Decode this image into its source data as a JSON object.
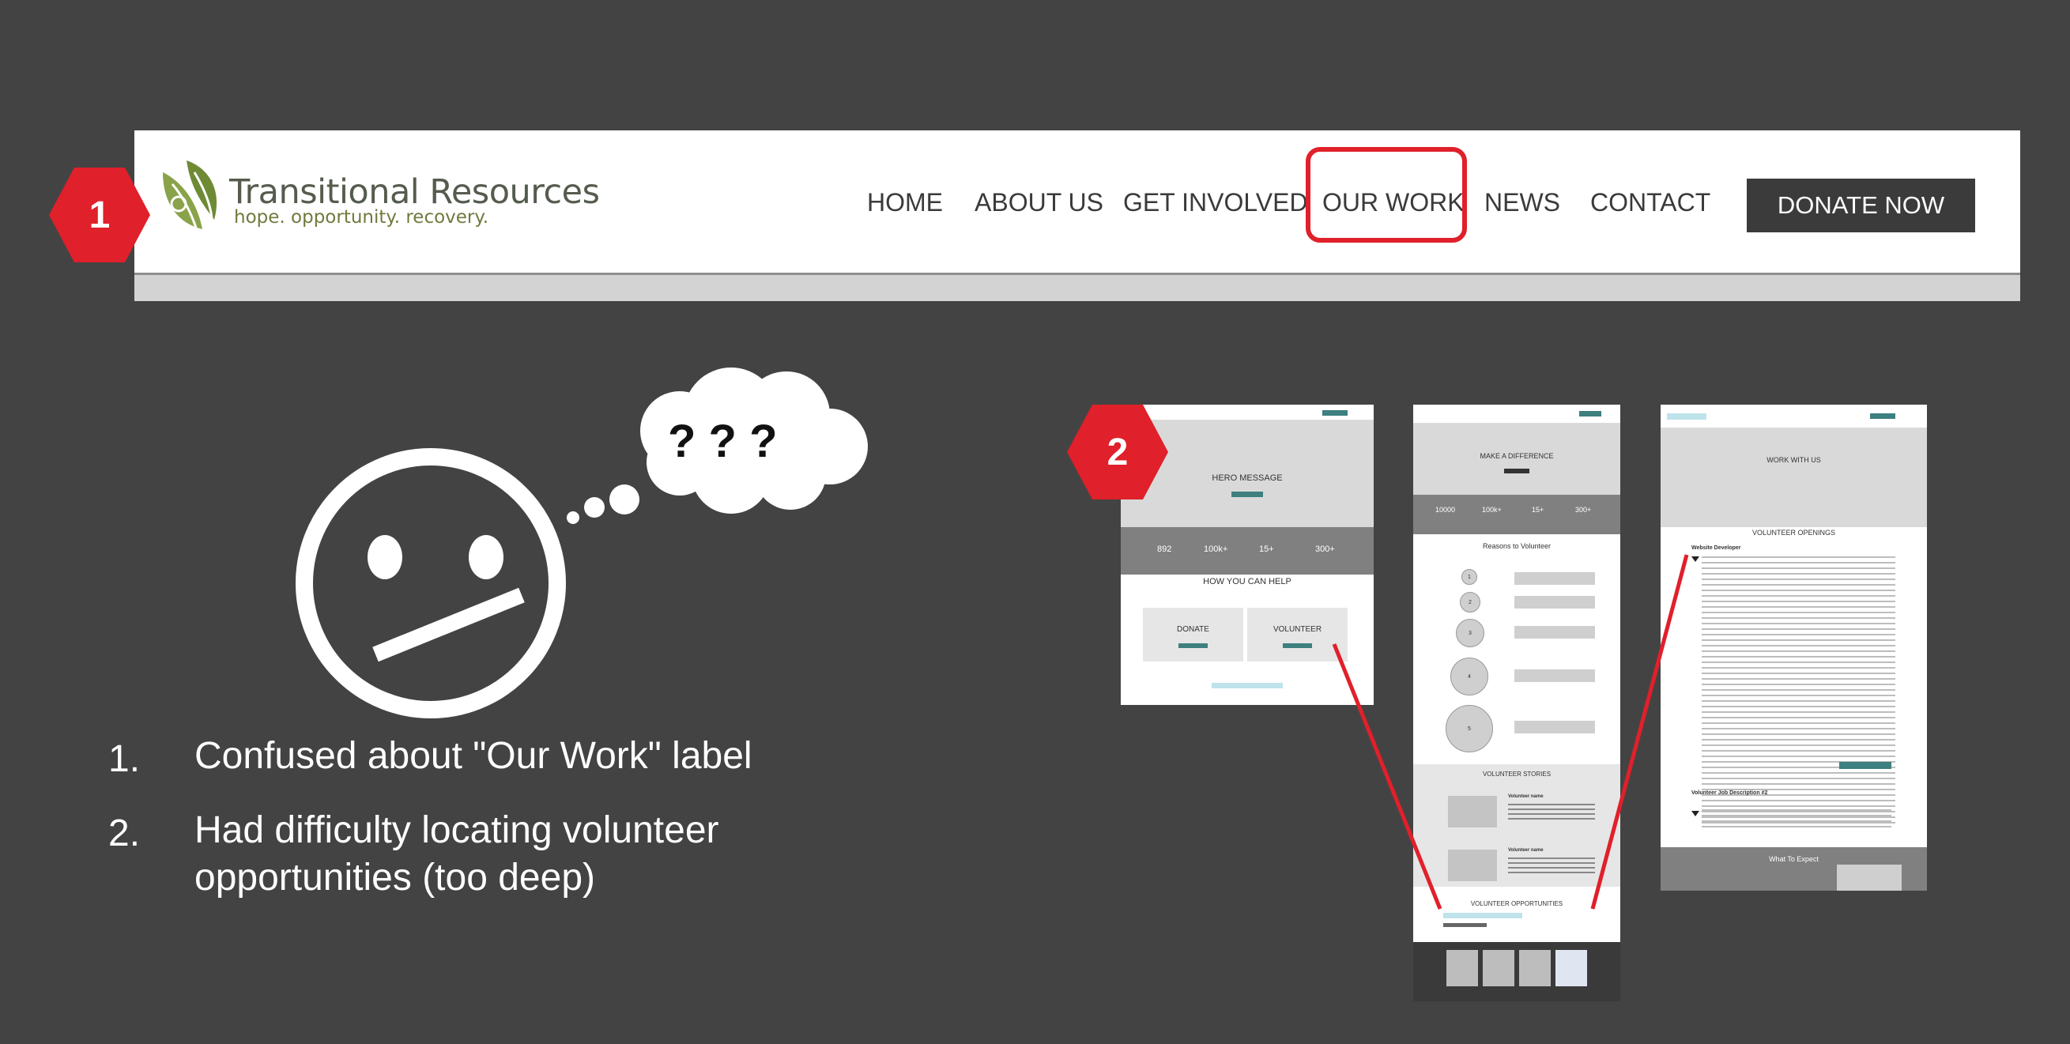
{
  "header": {
    "logo": {
      "title": "Transitional Resources",
      "tagline": "hope. opportunity. recovery."
    },
    "nav": [
      {
        "label": "HOME"
      },
      {
        "label": "ABOUT US"
      },
      {
        "label": "GET INVOLVED"
      },
      {
        "label": "OUR WORK",
        "highlighted": true
      },
      {
        "label": "NEWS"
      },
      {
        "label": "CONTACT"
      }
    ],
    "cta": "DONATE NOW",
    "callout_number": "1"
  },
  "thought": {
    "bubble_text": "? ? ?",
    "face_icon": "confused-face-icon"
  },
  "findings": [
    {
      "number": "1.",
      "text": "Confused about \"Our Work\" label"
    },
    {
      "number": "2.",
      "text": "Had difficulty locating volunteer opportunities (too deep)"
    }
  ],
  "wireframes": {
    "callout_number": "2",
    "page1": {
      "hero": "HERO MESSAGE",
      "stats": [
        "892",
        "100k+",
        "15+",
        "300+"
      ],
      "section_title": "HOW YOU CAN HELP",
      "cards": [
        "DONATE",
        "VOLUNTEER"
      ]
    },
    "page2": {
      "hero": "MAKE A DIFFERENCE",
      "stats": [
        "10000",
        "100k+",
        "15+",
        "300+"
      ],
      "reasons_title": "Reasons to Volunteer",
      "steps": [
        "1",
        "2",
        "3",
        "4",
        "5"
      ],
      "stories_title": "VOLUNTEER STORIES",
      "story_names": [
        "Volunteer name",
        "Volunteer name"
      ],
      "opportunities_title": "VOLUNTEER OPPORTUNITIES"
    },
    "page3": {
      "hero": "WORK WITH US",
      "openings_title": "VOLUNTEER OPENINGS",
      "job1": "Website Developer",
      "job2": "Volunteer Job Description #2",
      "footer_title": "What To Expect"
    }
  },
  "colors": {
    "background": "#434343",
    "accent_red": "#e0202a",
    "wireframe_teal": "#3e7f7f"
  }
}
